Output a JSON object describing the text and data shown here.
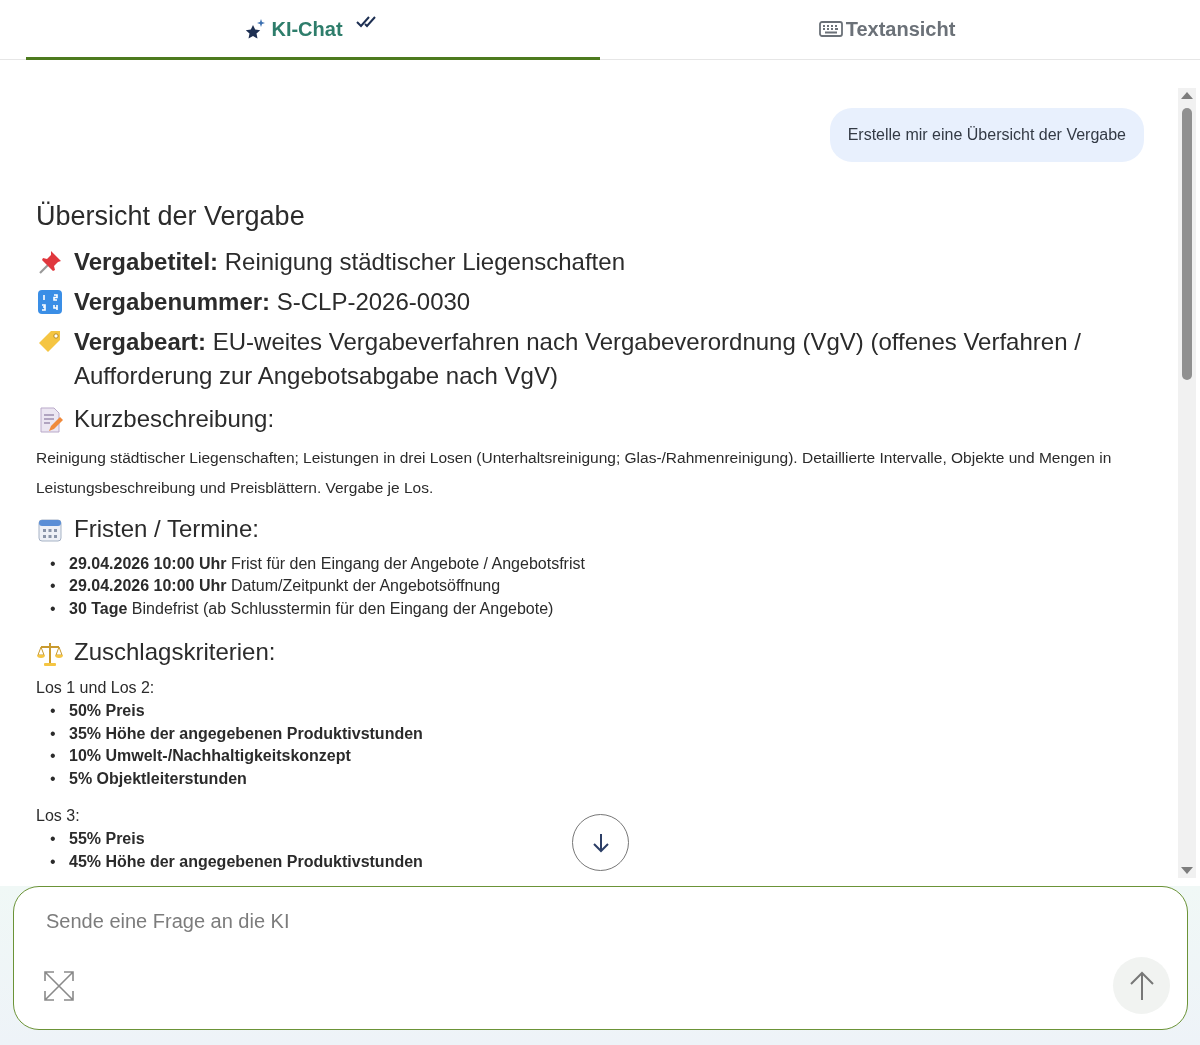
{
  "tabs": [
    {
      "kind": "chat",
      "label": "KI-Chat",
      "selected": true,
      "read": true
    },
    {
      "kind": "text",
      "label": "Textansicht",
      "selected": false
    }
  ],
  "messages": [
    {
      "kind": "user",
      "text": "Erstelle mir eine Übersicht der Vergabe"
    }
  ],
  "answer": [
    {
      "kind": "title",
      "text": "Übersicht der Vergabe"
    },
    {
      "kind": "field-title",
      "text": "**Vergabetitel:** Reinigung städtischer Liegenschaften"
    },
    {
      "kind": "field-number",
      "text": "**Vergabenummer:** S-CLP-2026-0030"
    },
    {
      "kind": "field-type",
      "text": "**Vergabeart:** EU-weites Vergabeverfahren nach Vergabeverordnung (VgV) (offenes Verfahren / Aufforderung zur Angebotsabgabe nach VgV)"
    },
    {
      "kind": "section-description",
      "text": "Kurzbeschreibung:"
    },
    {
      "kind": "paragraph",
      "text": "Reinigung städtischer Liegenschaften; Leistungen in drei Losen (Unterhaltsreinigung; Glas-/Rahmenreinigung). Detaillierte Intervalle, Objekte und Mengen in Leistungsbeschreibung und Preisblättern. Vergabe je Los."
    },
    {
      "kind": "section-deadlines",
      "text": "Fristen / Termine:"
    },
    {
      "kind": "list",
      "marker": "•",
      "items": [
        "**29.04.2026 10:00 Uhr** Frist für den Eingang der Angebote / Angebotsfrist",
        "**29.04.2026 10:00 Uhr** Datum/Zeitpunkt der Angebotsöffnung",
        "**30 Tage** Bindefrist (ab Schlusstermin für den Eingang der Angebote)"
      ]
    },
    {
      "kind": "section-criteria",
      "text": "Zuschlagskriterien:"
    },
    {
      "kind": "label",
      "text": "Los 1 und Los 2:"
    },
    {
      "kind": "strong-list",
      "marker": "•",
      "items": [
        "50% Preis",
        "35% Höhe der angegebenen Produktivstunden",
        "10% Umwelt-/Nachhaltigkeitskonzept",
        "5% Objektleiterstunden"
      ]
    },
    {
      "kind": "label",
      "text": "Los 3:"
    },
    {
      "kind": "strong-list",
      "marker": "•",
      "items": [
        "55% Preis",
        "45% Höhe der angegebenen Produktivstunden"
      ]
    }
  ],
  "composer": {
    "placeholder": "Sende eine Frage an die KI"
  }
}
